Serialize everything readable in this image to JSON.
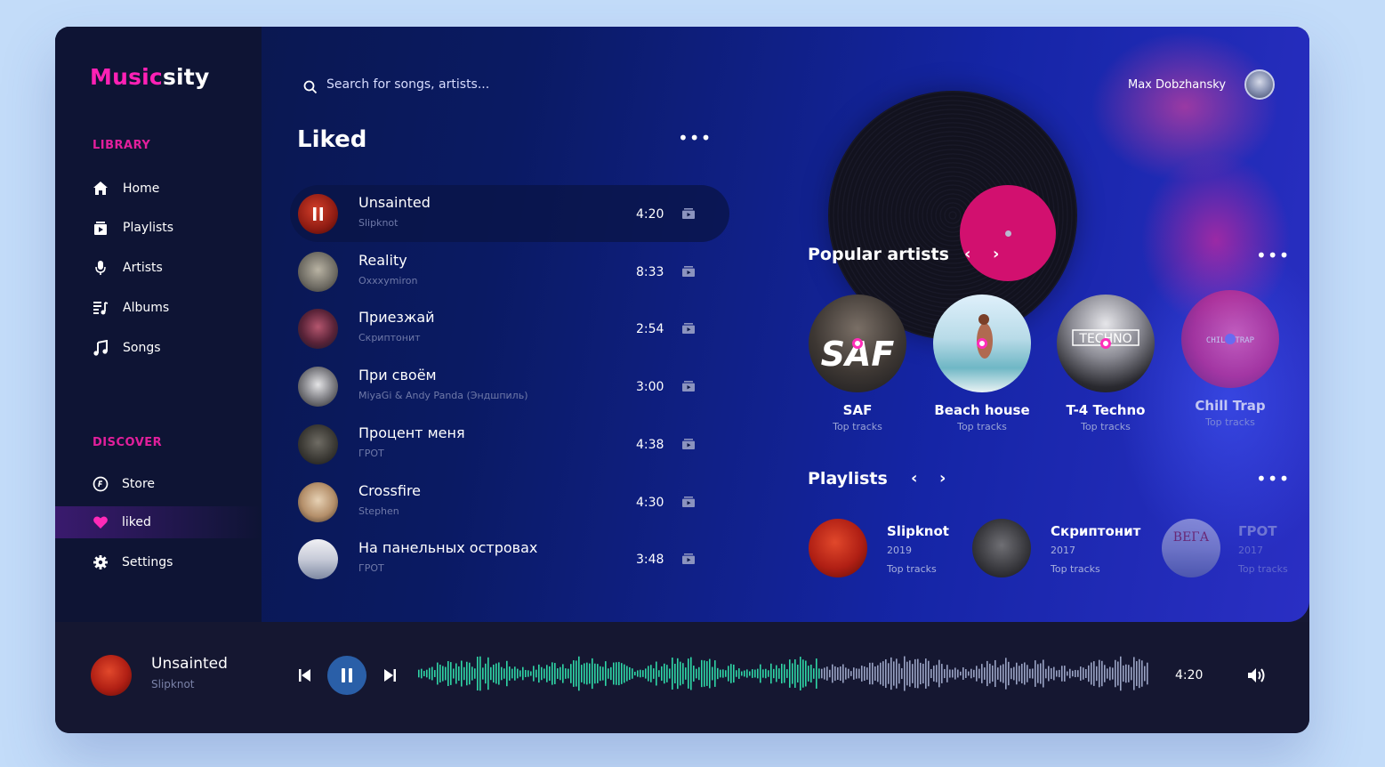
{
  "app": {
    "logo_part1": "Music",
    "logo_part2": "sity"
  },
  "sidebar": {
    "library_title": "LIBRARY",
    "library_items": [
      {
        "label": "Home",
        "icon": "home-icon"
      },
      {
        "label": "Playlists",
        "icon": "playlist-icon"
      },
      {
        "label": "Artists",
        "icon": "microphone-icon"
      },
      {
        "label": "Albums",
        "icon": "album-icon"
      },
      {
        "label": "Songs",
        "icon": "music-note-icon"
      }
    ],
    "discover_title": "DISCOVER",
    "discover_items": [
      {
        "label": "Store",
        "icon": "store-icon"
      },
      {
        "label": "liked",
        "icon": "heart-icon",
        "active": true
      },
      {
        "label": "Settings",
        "icon": "gear-icon"
      }
    ]
  },
  "search": {
    "placeholder": "Search for songs, artists..."
  },
  "liked": {
    "title": "Liked",
    "more_label": "•••",
    "tracks": [
      {
        "title": "Unsainted",
        "artist": "Slipknot",
        "duration": "4:20",
        "playing": true
      },
      {
        "title": "Reality",
        "artist": "Oxxxymiron",
        "duration": "8:33"
      },
      {
        "title": "Приезжай",
        "artist": "Скриптонит",
        "duration": "2:54"
      },
      {
        "title": "При своём",
        "artist": "MiyaGi & Andy Panda (Эндшпиль)",
        "duration": "3:00"
      },
      {
        "title": "Процент меня",
        "artist": "ГРОТ",
        "duration": "4:38"
      },
      {
        "title": "Crossfire",
        "artist": "Stephen",
        "duration": "4:30"
      },
      {
        "title": "На панельных островах",
        "artist": "ГРОТ",
        "duration": "3:48"
      }
    ]
  },
  "user": {
    "name": "Max Dobzhansky"
  },
  "popular_artists": {
    "title": "Popular artists",
    "more_label": "•••",
    "prev_label": "‹",
    "next_label": "›",
    "items": [
      {
        "name": "SAF",
        "sub": "Top tracks",
        "cover_text": "SAF"
      },
      {
        "name": "Beach house",
        "sub": "Top tracks"
      },
      {
        "name": "T-4 Techno",
        "sub": "Top tracks",
        "cover_text": "TECHNO"
      },
      {
        "name": "Chill Trap",
        "sub": "Top tracks",
        "cover_text": "CHILL TRAP"
      }
    ]
  },
  "playlists": {
    "title": "Playlists",
    "more_label": "•••",
    "prev_label": "‹",
    "next_label": "›",
    "items": [
      {
        "name": "Slipknot",
        "year": "2019",
        "sub": "Top tracks"
      },
      {
        "name": "Скриптонит",
        "year": "2017",
        "sub": "Top tracks"
      },
      {
        "name": "ГРОТ",
        "year": "2017",
        "sub": "Top tracks",
        "cover_text": "ВЕГА"
      }
    ]
  },
  "player": {
    "title": "Unsainted",
    "artist": "Slipknot",
    "time": "4:20",
    "progress": 0.55
  },
  "colors": {
    "accent": "#ff21b5",
    "active_play": "#2a5fa8",
    "wave_played": "#2fd6a6",
    "wave_remaining": "#9aa3c4"
  }
}
